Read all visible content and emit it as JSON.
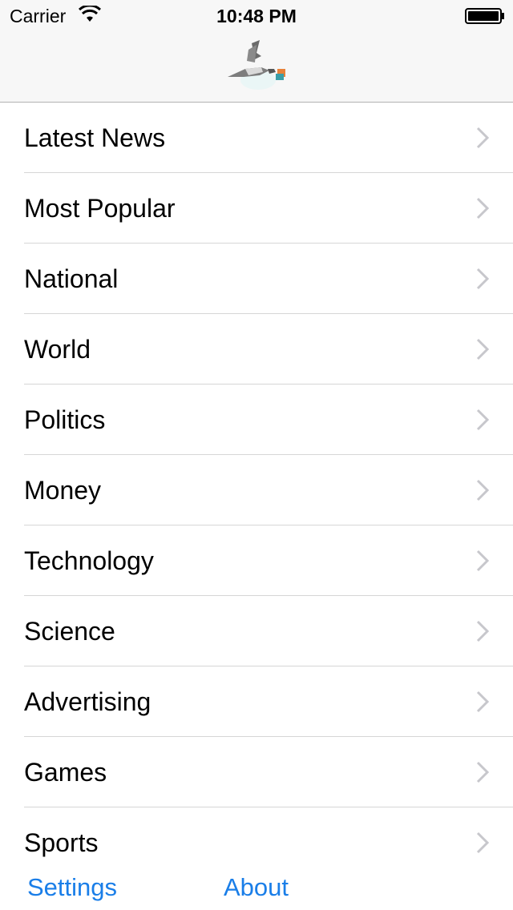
{
  "status_bar": {
    "carrier": "Carrier",
    "time": "10:48 PM"
  },
  "nav_bar": {
    "logo_icon": "stork-logo-icon"
  },
  "menu": {
    "items": [
      {
        "label": "Latest News"
      },
      {
        "label": "Most Popular"
      },
      {
        "label": "National"
      },
      {
        "label": "World"
      },
      {
        "label": "Politics"
      },
      {
        "label": "Money"
      },
      {
        "label": "Technology"
      },
      {
        "label": "Science"
      },
      {
        "label": "Advertising"
      },
      {
        "label": "Games"
      },
      {
        "label": "Sports"
      }
    ]
  },
  "toolbar": {
    "settings_label": "Settings",
    "about_label": "About"
  },
  "colors": {
    "accent": "#1a7ee8",
    "nav_background": "#f7f7f7",
    "separator": "#d6d6d6",
    "chevron": "#c7c7cc"
  }
}
